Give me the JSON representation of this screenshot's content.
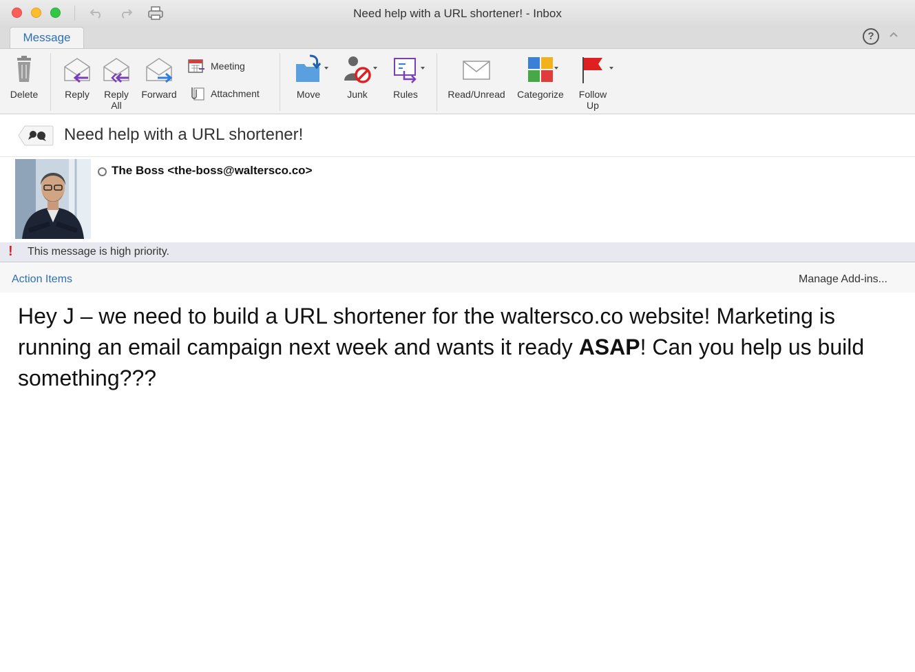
{
  "window": {
    "title": "Need help with a URL shortener! - Inbox",
    "buttons": [
      "close",
      "minimize",
      "maximize"
    ],
    "toolbar_icons": [
      "undo-icon",
      "redo-icon",
      "print-icon"
    ]
  },
  "tabs": [
    {
      "label": "Message",
      "active": true
    }
  ],
  "help_icon": "?",
  "ribbon": {
    "delete": "Delete",
    "reply": "Reply",
    "reply_all_1": "Reply",
    "reply_all_2": "All",
    "forward": "Forward",
    "meeting": "Meeting",
    "attachment": "Attachment",
    "move": "Move",
    "junk": "Junk",
    "rules": "Rules",
    "read_unread": "Read/Unread",
    "categorize": "Categorize",
    "follow_up_1": "Follow",
    "follow_up_2": "Up"
  },
  "message": {
    "subject": "Need help with a URL shortener!",
    "sender": "The Boss <the-boss@waltersco.co>",
    "priority_text": "This message is high priority.",
    "action_items": "Action Items",
    "manage_addins": "Manage Add-ins...",
    "body_part1": "Hey J – we need to build a URL shortener for the waltersco.co website!  Marketing is running an email campaign next week and wants it ready ",
    "body_bold": "ASAP",
    "body_part2": "!  Can you help us build something???"
  },
  "colors": {
    "accent": "#2d6fb5",
    "priority_red": "#d0262b",
    "flag_red": "#e02020"
  }
}
